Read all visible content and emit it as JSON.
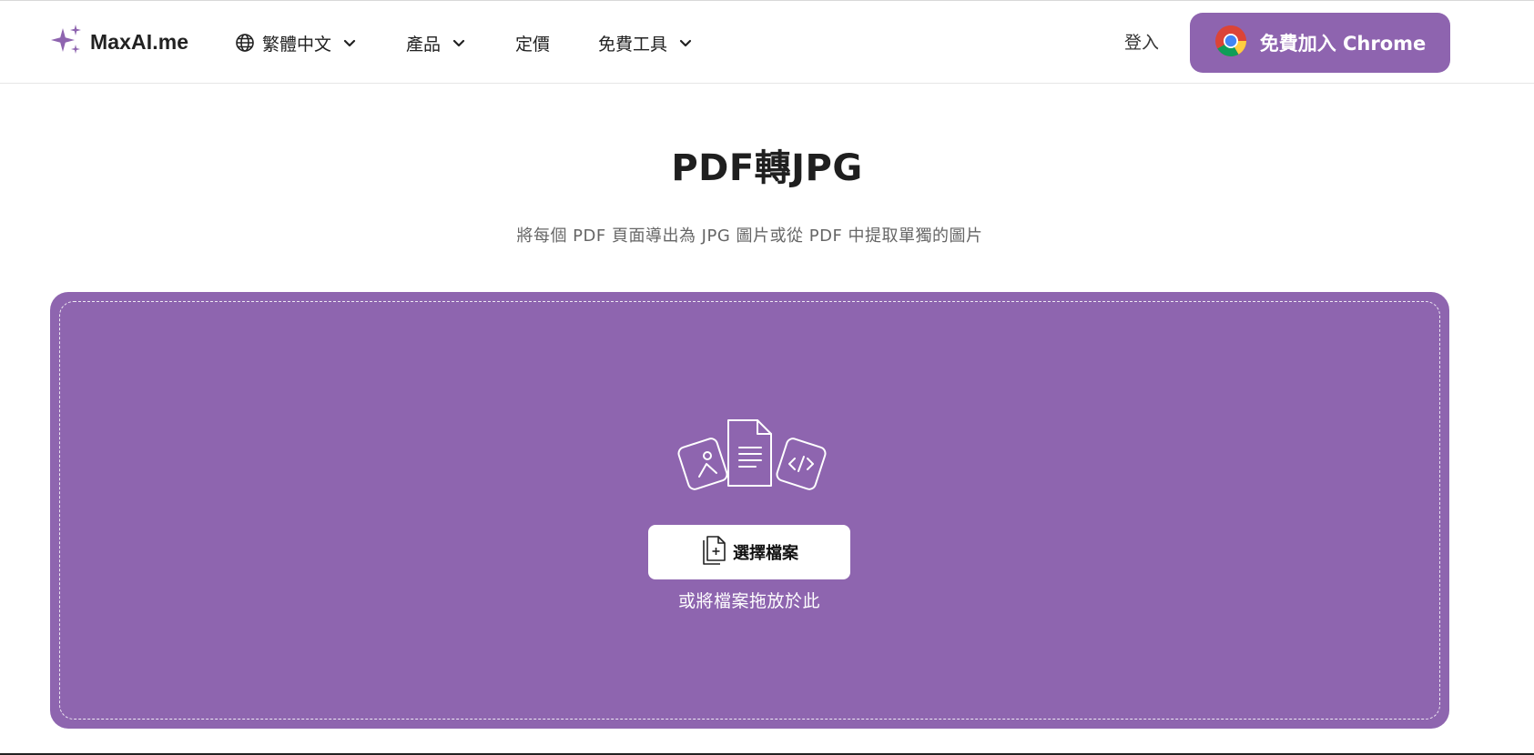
{
  "header": {
    "logo_text": "MaxAI.me",
    "nav": [
      {
        "label": "繁體中文",
        "icon_left": "globe-icon",
        "dropdown": true
      },
      {
        "label": "產品",
        "dropdown": true
      },
      {
        "label": "定價",
        "dropdown": false
      },
      {
        "label": "免費工具",
        "dropdown": true
      }
    ],
    "login_label": "登入",
    "cta_label": "免費加入 Chrome",
    "cta_icon": "chrome-icon"
  },
  "main": {
    "title": "PDF轉JPG",
    "subtitle": "將每個 PDF 頁面導出為 JPG 圖片或從 PDF 中提取單獨的圖片",
    "choose_button_label": "選擇檔案",
    "drop_hint": "或將檔案拖放於此"
  },
  "colors": {
    "brand_purple": "#8e64af",
    "text_dark": "#1f1f1f",
    "text_muted": "#666666"
  }
}
